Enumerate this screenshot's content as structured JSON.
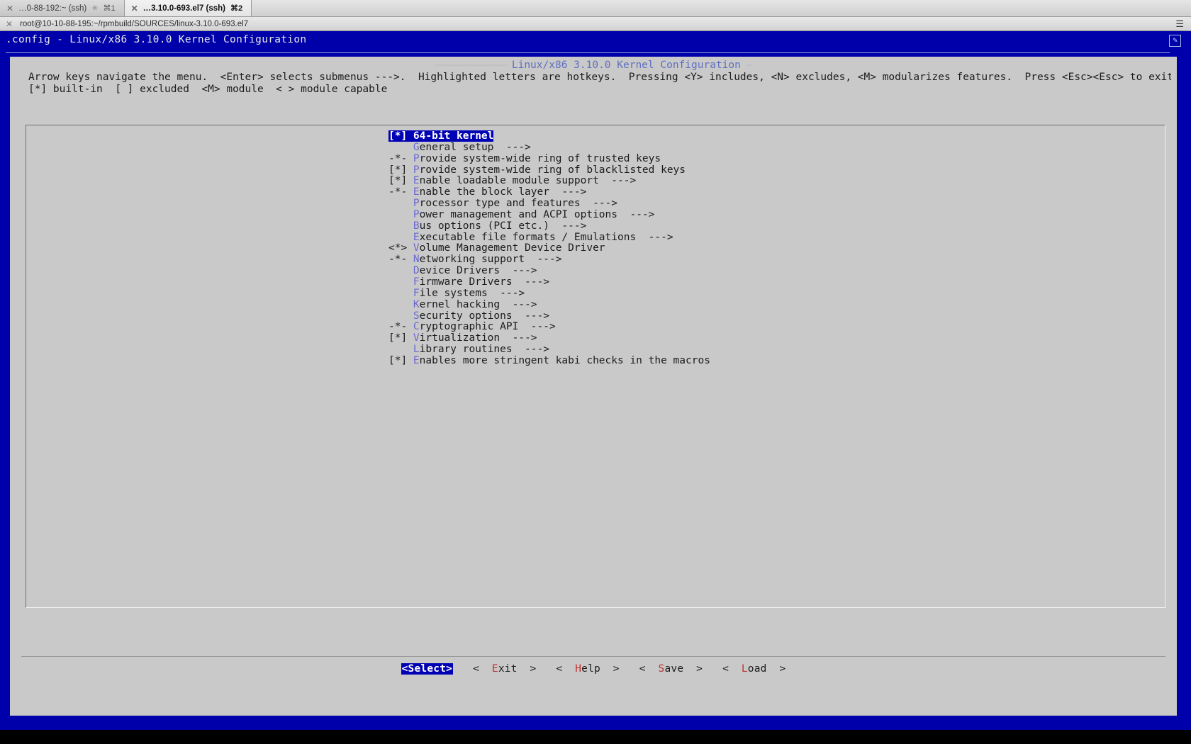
{
  "window": {
    "tabs": [
      {
        "label": "…0-88-192:~ (ssh)",
        "shortcut": "⌘1",
        "active": false,
        "busy": true
      },
      {
        "label": "…3.10.0-693.el7 (ssh)",
        "shortcut": "⌘2",
        "active": true,
        "busy": false
      }
    ],
    "title": "root@10-10-88-195:~/rpmbuild/SOURCES/linux-3.10.0-693.el7",
    "close_icon": "close-icon",
    "menu_icon": "hamburger-icon"
  },
  "screen": {
    "backtitle": ".config - Linux/x86 3.10.0 Kernel Configuration",
    "corner_icon": "edit-icon",
    "dialog_title": "Linux/x86 3.10.0 Kernel Configuration",
    "title_dash_left": "————————————— ",
    "title_dash_right": " —",
    "help_line_1": "Arrow keys navigate the menu.  <Enter> selects submenus --->.  Highlighted letters are hotkeys.  Pressing <Y> includes, <N> excludes, <M> modularizes features.  Press <Esc><Esc> to exit, <?> for Help, </> for Search.  Legend:",
    "help_line_2": "[*] built-in  [ ] excluded  <M> module  < > module capable"
  },
  "menu": {
    "items": [
      {
        "mark": "[*]",
        "hotkey": "",
        "pre": "",
        "text": "64-bit kernel",
        "arrow": "",
        "selected": true
      },
      {
        "mark": "",
        "hotkey": "G",
        "pre": "",
        "text": "eneral setup",
        "arrow": "  --->",
        "selected": false
      },
      {
        "mark": "-*-",
        "hotkey": "P",
        "pre": "",
        "text": "rovide system-wide ring of trusted keys",
        "arrow": "",
        "selected": false
      },
      {
        "mark": "[*]",
        "hotkey": "P",
        "pre": "",
        "text": "rovide system-wide ring of blacklisted keys",
        "arrow": "",
        "selected": false
      },
      {
        "mark": "[*]",
        "hotkey": "E",
        "pre": "",
        "text": "nable loadable module support",
        "arrow": "  --->",
        "selected": false
      },
      {
        "mark": "-*-",
        "hotkey": "E",
        "pre": "",
        "text": "nable the block layer",
        "arrow": "  --->",
        "selected": false
      },
      {
        "mark": "",
        "hotkey": "P",
        "pre": "",
        "text": "rocessor type and features",
        "arrow": "  --->",
        "selected": false
      },
      {
        "mark": "",
        "hotkey": "P",
        "pre": "",
        "text": "ower management and ACPI options",
        "arrow": "  --->",
        "selected": false
      },
      {
        "mark": "",
        "hotkey": "B",
        "pre": "",
        "text": "us options (PCI etc.)",
        "arrow": "  --->",
        "selected": false
      },
      {
        "mark": "",
        "hotkey": "E",
        "pre": "",
        "text": "xecutable file formats / Emulations",
        "arrow": "  --->",
        "selected": false
      },
      {
        "mark": "<*>",
        "hotkey": "V",
        "pre": "",
        "text": "olume Management Device Driver",
        "arrow": "",
        "selected": false
      },
      {
        "mark": "-*-",
        "hotkey": "N",
        "pre": "",
        "text": "etworking support",
        "arrow": "  --->",
        "selected": false
      },
      {
        "mark": "",
        "hotkey": "D",
        "pre": "",
        "text": "evice Drivers",
        "arrow": "  --->",
        "selected": false
      },
      {
        "mark": "",
        "hotkey": "F",
        "pre": "",
        "text": "irmware Drivers",
        "arrow": "  --->",
        "selected": false
      },
      {
        "mark": "",
        "hotkey": "F",
        "pre": "",
        "text": "ile systems",
        "arrow": "  --->",
        "selected": false
      },
      {
        "mark": "",
        "hotkey": "K",
        "pre": "",
        "text": "ernel hacking",
        "arrow": "  --->",
        "selected": false
      },
      {
        "mark": "",
        "hotkey": "S",
        "pre": "",
        "text": "ecurity options",
        "arrow": "  --->",
        "selected": false
      },
      {
        "mark": "-*-",
        "hotkey": "C",
        "pre": "",
        "text": "ryptographic API",
        "arrow": "  --->",
        "selected": false
      },
      {
        "mark": "[*]",
        "hotkey": "V",
        "pre": "",
        "text": "irtualization",
        "arrow": "  --->",
        "selected": false
      },
      {
        "mark": "",
        "hotkey": "L",
        "pre": "",
        "text": "ibrary routines",
        "arrow": "  --->",
        "selected": false
      },
      {
        "mark": "[*]",
        "hotkey": "E",
        "pre": "",
        "text": "nables more stringent kabi checks in the macros",
        "arrow": "",
        "selected": false
      }
    ]
  },
  "buttons": [
    {
      "name": "select",
      "left": "<",
      "hotkey": "S",
      "rest": "elect",
      "right": ">",
      "active": true
    },
    {
      "name": "exit",
      "left": "<  ",
      "hotkey": "E",
      "rest": "xit  ",
      "right": ">",
      "active": false
    },
    {
      "name": "help",
      "left": "<  ",
      "hotkey": "H",
      "rest": "elp  ",
      "right": ">",
      "active": false
    },
    {
      "name": "save",
      "left": "<  ",
      "hotkey": "S",
      "rest": "ave  ",
      "right": ">",
      "active": false
    },
    {
      "name": "load",
      "left": "<  ",
      "hotkey": "L",
      "rest": "oad  ",
      "right": ">",
      "active": false
    }
  ],
  "colors": {
    "terminal_bg": "#0000aa",
    "dialog_bg": "#c9c9c9",
    "highlight_bg": "#0000b4",
    "hotkey_menu": "#6a6ad0",
    "hotkey_button": "#c03030",
    "dialog_title": "#5f6fc0"
  }
}
